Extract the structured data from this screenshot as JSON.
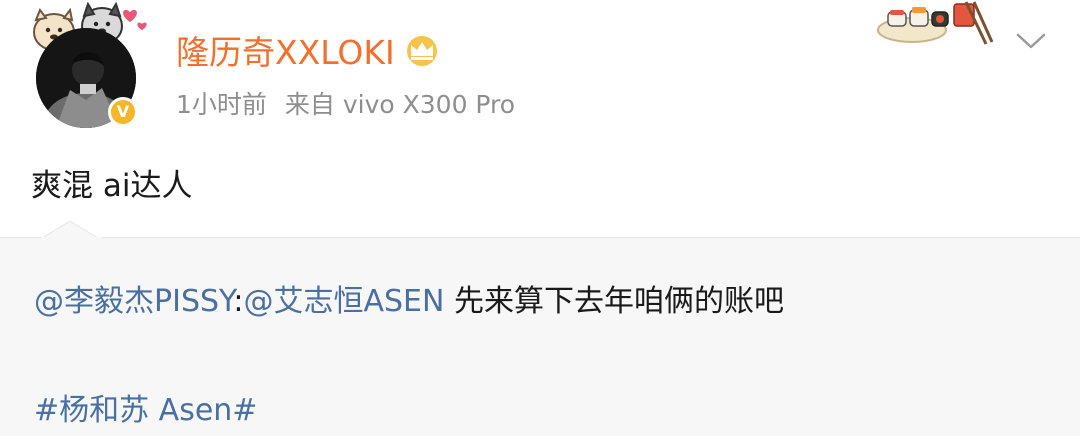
{
  "post": {
    "author": {
      "username": "隆历奇XXLOKI",
      "verified_icon": "verified-badge-icon",
      "crown_icon": "crown-icon",
      "badge_glyph": "V"
    },
    "meta": {
      "time": "1小时前",
      "source": "来自 vivo X300 Pro"
    },
    "text": "爽混 ai达人",
    "menu_icon": "chevron-down-icon"
  },
  "repost": {
    "mention_1": "@李毅杰PISSY",
    "separator": ":",
    "mention_2": "@艾志恒ASEN",
    "body": " 先来算下去年咱俩的账吧",
    "hashtag": "#杨和苏 Asen#"
  },
  "colors": {
    "username": "#f2702c",
    "link": "#4a6fa1",
    "meta": "#8e8e8e",
    "repost_bg": "#f7f7f7",
    "badge": "#f6b62a"
  }
}
